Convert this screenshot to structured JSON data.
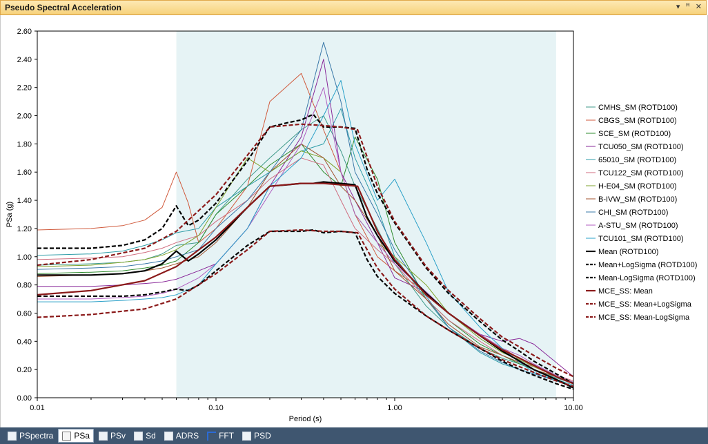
{
  "window": {
    "title": "Pseudo Spectral Acceleration",
    "buttons": {
      "dropdown": "▾",
      "pin": "ꟸ",
      "close": "✕"
    }
  },
  "tabs": [
    {
      "label": "PSpectra",
      "icon": "pspectra-icon",
      "active": false
    },
    {
      "label": "PSa",
      "icon": "psa-icon",
      "active": true
    },
    {
      "label": "PSv",
      "icon": "psv-icon",
      "active": false
    },
    {
      "label": "Sd",
      "icon": "sd-icon",
      "active": false
    },
    {
      "label": "ADRS",
      "icon": "adrs-icon",
      "active": false
    },
    {
      "label": "FFT",
      "icon": "fft-icon",
      "active": false
    },
    {
      "label": "PSD",
      "icon": "psd-icon",
      "active": false
    }
  ],
  "chart_data": {
    "type": "line",
    "xscale": "log",
    "xlabel": "Period (s)",
    "ylabel": "PSa (g)",
    "xlim": [
      0.01,
      10
    ],
    "ylim": [
      0,
      2.6
    ],
    "xticks": [
      "0.01",
      "0.10",
      "1.00",
      "10.00"
    ],
    "yticks": [
      "0.00",
      "0.20",
      "0.40",
      "0.60",
      "0.80",
      "1.00",
      "1.20",
      "1.40",
      "1.60",
      "1.80",
      "2.00",
      "2.20",
      "2.40",
      "2.60"
    ],
    "shaded_range": [
      0.06,
      8.0
    ],
    "shade_color": "#e6f3f5",
    "legend_position": "right",
    "series": [
      {
        "name": "CMHS_SM (ROTD100)",
        "color": "#3f9a8a",
        "width": 1,
        "dash": "solid",
        "x": [
          0.01,
          0.02,
          0.03,
          0.04,
          0.05,
          0.06,
          0.08,
          0.1,
          0.15,
          0.2,
          0.3,
          0.4,
          0.5,
          0.6,
          0.8,
          1,
          1.5,
          2,
          3,
          4,
          5,
          6,
          8,
          10
        ],
        "y": [
          0.94,
          0.95,
          0.96,
          0.98,
          1.02,
          1.08,
          1.1,
          1.3,
          1.55,
          1.7,
          1.9,
          2.0,
          1.75,
          1.5,
          1.2,
          0.95,
          0.65,
          0.5,
          0.35,
          0.28,
          0.24,
          0.2,
          0.14,
          0.1
        ]
      },
      {
        "name": "CBGS_SM (ROTD100)",
        "color": "#d05a3c",
        "width": 1,
        "dash": "solid",
        "x": [
          0.01,
          0.02,
          0.03,
          0.04,
          0.05,
          0.06,
          0.07,
          0.08,
          0.1,
          0.15,
          0.2,
          0.3,
          0.4,
          0.5,
          0.6,
          0.8,
          1,
          1.5,
          2,
          3,
          4,
          5,
          6,
          8,
          10
        ],
        "y": [
          1.19,
          1.2,
          1.22,
          1.26,
          1.35,
          1.6,
          1.38,
          1.1,
          1.2,
          1.5,
          2.1,
          2.3,
          1.9,
          1.6,
          1.3,
          1.0,
          0.9,
          0.75,
          0.6,
          0.45,
          0.35,
          0.28,
          0.22,
          0.15,
          0.1
        ]
      },
      {
        "name": "SCE_SM (ROTD100)",
        "color": "#2e8b2e",
        "width": 1,
        "dash": "solid",
        "x": [
          0.01,
          0.02,
          0.03,
          0.04,
          0.05,
          0.06,
          0.08,
          0.1,
          0.15,
          0.2,
          0.3,
          0.4,
          0.5,
          0.6,
          0.8,
          1,
          1.5,
          2,
          3,
          4,
          5,
          6,
          8,
          10
        ],
        "y": [
          0.88,
          0.89,
          0.9,
          0.92,
          0.94,
          0.97,
          1.1,
          1.3,
          1.5,
          1.65,
          1.8,
          1.6,
          1.5,
          1.85,
          1.55,
          1.1,
          0.7,
          0.55,
          0.38,
          0.3,
          0.24,
          0.2,
          0.15,
          0.11
        ]
      },
      {
        "name": "TCU050_SM (ROTD100)",
        "color": "#8a2a9a",
        "width": 1,
        "dash": "solid",
        "x": [
          0.01,
          0.02,
          0.03,
          0.04,
          0.05,
          0.06,
          0.08,
          0.1,
          0.15,
          0.2,
          0.3,
          0.4,
          0.5,
          0.6,
          0.8,
          1,
          1.5,
          2,
          3,
          4,
          5,
          6,
          8,
          10
        ],
        "y": [
          0.79,
          0.79,
          0.8,
          0.81,
          0.82,
          0.84,
          0.9,
          0.95,
          1.2,
          1.5,
          1.85,
          2.4,
          1.6,
          1.4,
          1.1,
          0.85,
          0.75,
          0.6,
          0.45,
          0.4,
          0.42,
          0.38,
          0.25,
          0.15
        ]
      },
      {
        "name": "65010_SM (ROTD100)",
        "color": "#2f9da8",
        "width": 1,
        "dash": "solid",
        "x": [
          0.01,
          0.02,
          0.03,
          0.04,
          0.05,
          0.06,
          0.08,
          0.1,
          0.15,
          0.2,
          0.3,
          0.4,
          0.5,
          0.6,
          0.8,
          1,
          1.5,
          2,
          3,
          4,
          5,
          6,
          8,
          10
        ],
        "y": [
          1.01,
          1.02,
          1.04,
          1.08,
          1.12,
          1.17,
          1.2,
          1.35,
          1.5,
          1.6,
          1.75,
          1.8,
          2.05,
          1.7,
          1.35,
          1.0,
          0.7,
          0.5,
          0.32,
          0.24,
          0.2,
          0.17,
          0.13,
          0.09
        ]
      },
      {
        "name": "TCU122_SM (ROTD100)",
        "color": "#d06e80",
        "width": 1,
        "dash": "solid",
        "x": [
          0.01,
          0.02,
          0.03,
          0.04,
          0.05,
          0.06,
          0.08,
          0.1,
          0.15,
          0.2,
          0.3,
          0.4,
          0.5,
          0.6,
          0.8,
          1,
          1.5,
          2,
          3,
          4,
          5,
          6,
          8,
          10
        ],
        "y": [
          0.98,
          0.99,
          1.0,
          1.03,
          1.06,
          1.1,
          1.15,
          1.25,
          1.4,
          1.55,
          1.7,
          1.65,
          1.4,
          1.2,
          1.05,
          0.95,
          0.7,
          0.55,
          0.4,
          0.3,
          0.25,
          0.22,
          0.16,
          0.12
        ]
      },
      {
        "name": "H-E04_SM (ROTD100)",
        "color": "#7fa32c",
        "width": 1,
        "dash": "solid",
        "x": [
          0.01,
          0.02,
          0.03,
          0.04,
          0.05,
          0.06,
          0.08,
          0.1,
          0.15,
          0.2,
          0.3,
          0.4,
          0.5,
          0.6,
          0.8,
          1,
          1.5,
          2,
          3,
          4,
          5,
          6,
          8,
          10
        ],
        "y": [
          0.93,
          0.94,
          0.96,
          0.98,
          1.01,
          1.05,
          1.15,
          1.35,
          1.7,
          1.6,
          1.75,
          1.7,
          1.6,
          1.3,
          1.1,
          1.0,
          0.8,
          0.6,
          0.42,
          0.32,
          0.27,
          0.22,
          0.16,
          0.11
        ]
      },
      {
        "name": "B-IVW_SM (ROTD100)",
        "color": "#a0522d",
        "width": 1,
        "dash": "solid",
        "x": [
          0.01,
          0.02,
          0.03,
          0.04,
          0.05,
          0.06,
          0.08,
          0.1,
          0.15,
          0.2,
          0.3,
          0.4,
          0.5,
          0.6,
          0.8,
          1,
          1.5,
          2,
          3,
          4,
          5,
          6,
          8,
          10
        ],
        "y": [
          0.86,
          0.87,
          0.88,
          0.9,
          0.92,
          0.95,
          1.0,
          1.1,
          1.35,
          1.6,
          1.8,
          1.7,
          1.5,
          1.4,
          1.15,
          0.9,
          0.7,
          0.52,
          0.36,
          0.3,
          0.25,
          0.2,
          0.15,
          0.1
        ]
      },
      {
        "name": "CHI_SM (ROTD100)",
        "color": "#3a78a8",
        "width": 1,
        "dash": "solid",
        "x": [
          0.01,
          0.02,
          0.03,
          0.04,
          0.05,
          0.06,
          0.08,
          0.1,
          0.15,
          0.2,
          0.3,
          0.4,
          0.5,
          0.6,
          0.8,
          1,
          1.5,
          2,
          3,
          4,
          5,
          6,
          8,
          10
        ],
        "y": [
          0.91,
          0.92,
          0.93,
          0.95,
          0.97,
          1.0,
          1.05,
          1.2,
          1.4,
          1.6,
          1.9,
          2.52,
          2.1,
          1.6,
          1.3,
          1.05,
          0.72,
          0.5,
          0.33,
          0.25,
          0.2,
          0.17,
          0.12,
          0.08
        ]
      },
      {
        "name": "A-STU_SM (ROTD100)",
        "color": "#b05cc0",
        "width": 1,
        "dash": "solid",
        "x": [
          0.01,
          0.02,
          0.03,
          0.04,
          0.05,
          0.06,
          0.08,
          0.1,
          0.15,
          0.2,
          0.3,
          0.4,
          0.5,
          0.6,
          0.8,
          1,
          1.5,
          2,
          3,
          4,
          5,
          6,
          8,
          10
        ],
        "y": [
          0.7,
          0.7,
          0.71,
          0.72,
          0.74,
          0.77,
          0.85,
          0.95,
          1.2,
          1.45,
          1.8,
          2.2,
          1.6,
          1.3,
          1.1,
          0.95,
          0.75,
          0.6,
          0.45,
          0.35,
          0.3,
          0.24,
          0.16,
          0.11
        ]
      },
      {
        "name": "TCU101_SM (ROTD100)",
        "color": "#2aa0c8",
        "width": 1,
        "dash": "solid",
        "x": [
          0.01,
          0.02,
          0.03,
          0.04,
          0.05,
          0.06,
          0.08,
          0.1,
          0.15,
          0.2,
          0.3,
          0.4,
          0.5,
          0.6,
          0.8,
          1,
          1.5,
          2,
          3,
          4,
          5,
          6,
          8,
          10
        ],
        "y": [
          0.68,
          0.68,
          0.69,
          0.7,
          0.71,
          0.73,
          0.8,
          0.95,
          1.2,
          1.5,
          1.7,
          2.0,
          2.25,
          1.8,
          1.4,
          1.55,
          1.1,
          0.75,
          0.5,
          0.35,
          0.25,
          0.18,
          0.12,
          0.08
        ]
      },
      {
        "name": "Mean (ROTD100)",
        "color": "#000000",
        "width": 2.2,
        "dash": "solid",
        "x": [
          0.01,
          0.02,
          0.03,
          0.04,
          0.05,
          0.06,
          0.07,
          0.08,
          0.1,
          0.15,
          0.2,
          0.25,
          0.3,
          0.35,
          0.4,
          0.5,
          0.6,
          0.7,
          0.8,
          1,
          1.5,
          2,
          3,
          4,
          5,
          6,
          8,
          10
        ],
        "y": [
          0.87,
          0.87,
          0.88,
          0.9,
          0.95,
          1.04,
          0.97,
          1.02,
          1.12,
          1.35,
          1.5,
          1.51,
          1.52,
          1.52,
          1.53,
          1.52,
          1.51,
          1.28,
          1.15,
          0.97,
          0.74,
          0.6,
          0.44,
          0.33,
          0.26,
          0.2,
          0.13,
          0.07
        ]
      },
      {
        "name": "Mean+LogSigma (ROTD100)",
        "color": "#000000",
        "width": 2.2,
        "dash": "dashed",
        "x": [
          0.01,
          0.02,
          0.03,
          0.04,
          0.05,
          0.06,
          0.07,
          0.08,
          0.1,
          0.15,
          0.2,
          0.25,
          0.3,
          0.35,
          0.4,
          0.5,
          0.6,
          0.7,
          0.8,
          1,
          1.5,
          2,
          3,
          4,
          5,
          6,
          8,
          10
        ],
        "y": [
          1.06,
          1.06,
          1.08,
          1.12,
          1.2,
          1.36,
          1.22,
          1.26,
          1.38,
          1.68,
          1.92,
          1.95,
          1.97,
          2.01,
          1.92,
          1.92,
          1.91,
          1.62,
          1.45,
          1.24,
          0.92,
          0.74,
          0.54,
          0.41,
          0.33,
          0.26,
          0.17,
          0.1
        ]
      },
      {
        "name": "Mean-LogSigma (ROTD100)",
        "color": "#000000",
        "width": 2.2,
        "dash": "dashed",
        "x": [
          0.01,
          0.02,
          0.03,
          0.04,
          0.05,
          0.06,
          0.07,
          0.08,
          0.1,
          0.15,
          0.2,
          0.25,
          0.3,
          0.35,
          0.4,
          0.5,
          0.6,
          0.7,
          0.8,
          1,
          1.5,
          2,
          3,
          4,
          5,
          6,
          8,
          10
        ],
        "y": [
          0.72,
          0.72,
          0.72,
          0.73,
          0.75,
          0.77,
          0.76,
          0.8,
          0.9,
          1.08,
          1.18,
          1.18,
          1.18,
          1.19,
          1.17,
          1.18,
          1.17,
          0.98,
          0.86,
          0.74,
          0.58,
          0.48,
          0.35,
          0.26,
          0.2,
          0.16,
          0.1,
          0.06
        ]
      },
      {
        "name": "MCE_SS: Mean",
        "color": "#8b1a1a",
        "width": 2.2,
        "dash": "solid",
        "x": [
          0.01,
          0.02,
          0.04,
          0.06,
          0.1,
          0.15,
          0.2,
          0.3,
          0.4,
          0.5,
          0.62,
          0.8,
          1,
          1.5,
          2,
          3,
          4,
          5,
          6,
          8,
          10
        ],
        "y": [
          0.73,
          0.76,
          0.83,
          0.93,
          1.14,
          1.35,
          1.5,
          1.52,
          1.52,
          1.51,
          1.5,
          1.18,
          0.98,
          0.73,
          0.6,
          0.44,
          0.34,
          0.28,
          0.23,
          0.15,
          0.1
        ]
      },
      {
        "name": "MCE_SS: Mean+LogSigma",
        "color": "#8b1a1a",
        "width": 2.2,
        "dash": "dashed",
        "x": [
          0.01,
          0.02,
          0.04,
          0.06,
          0.1,
          0.15,
          0.2,
          0.3,
          0.4,
          0.5,
          0.62,
          0.8,
          1,
          1.5,
          2,
          3,
          4,
          5,
          6,
          8,
          10
        ],
        "y": [
          0.94,
          0.98,
          1.06,
          1.18,
          1.44,
          1.72,
          1.92,
          1.94,
          1.93,
          1.92,
          1.9,
          1.5,
          1.25,
          0.93,
          0.76,
          0.56,
          0.43,
          0.36,
          0.3,
          0.21,
          0.15
        ]
      },
      {
        "name": "MCE_SS: Mean-LogSigma",
        "color": "#8b1a1a",
        "width": 2.2,
        "dash": "dashed",
        "x": [
          0.01,
          0.02,
          0.04,
          0.06,
          0.1,
          0.15,
          0.2,
          0.3,
          0.4,
          0.5,
          0.62,
          0.8,
          1,
          1.5,
          2,
          3,
          4,
          5,
          6,
          8,
          10
        ],
        "y": [
          0.57,
          0.59,
          0.63,
          0.7,
          0.88,
          1.05,
          1.18,
          1.19,
          1.18,
          1.18,
          1.17,
          0.92,
          0.77,
          0.58,
          0.48,
          0.35,
          0.27,
          0.22,
          0.18,
          0.12,
          0.08
        ]
      }
    ]
  }
}
